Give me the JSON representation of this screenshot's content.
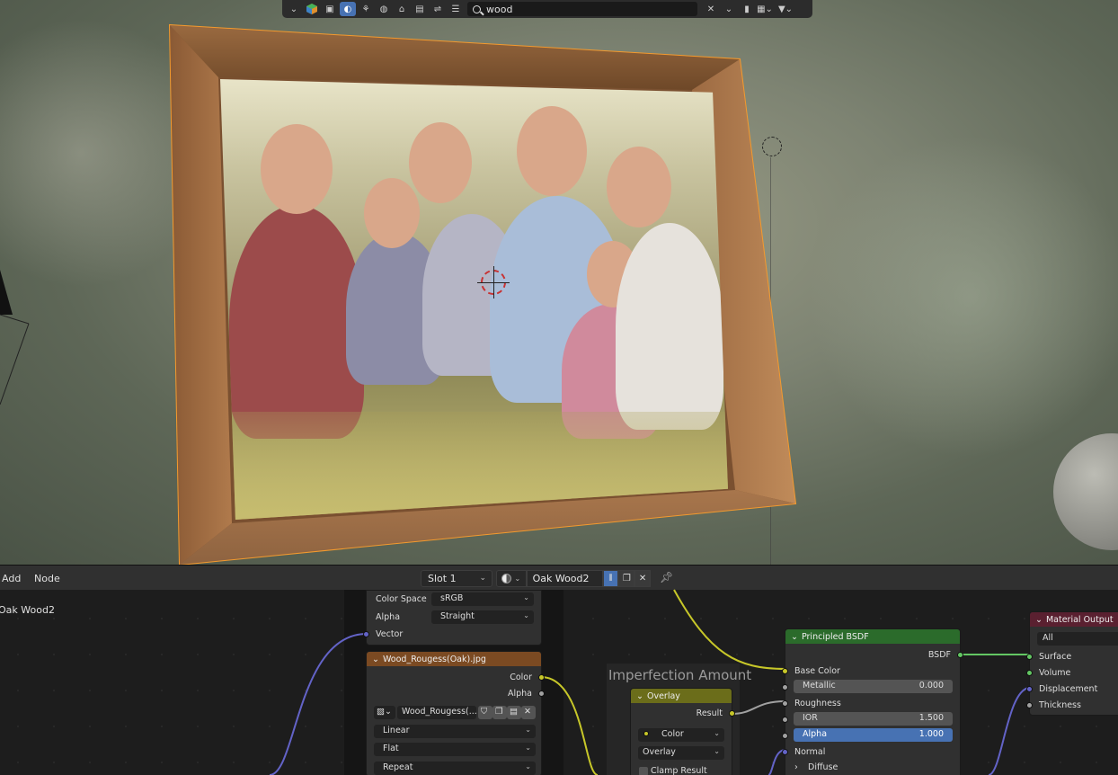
{
  "viewport_header": {
    "search_value": "wood"
  },
  "node_editor": {
    "menu": {
      "add": "Add",
      "node": "Node"
    },
    "slot": "Slot 1",
    "material_name": "Oak Wood2",
    "left_label": "Oak Wood2",
    "frame_label": "Imperfection Amount",
    "image_node_top": {
      "color_space_label": "Color Space",
      "color_space_value": "sRGB",
      "alpha_label": "Alpha",
      "alpha_value": "Straight",
      "vector_label": "Vector"
    },
    "image_node": {
      "title": "Wood_Rougess(Oak).jpg",
      "out_color": "Color",
      "out_alpha": "Alpha",
      "image_name": "Wood_Rougess(...",
      "interpolation": "Linear",
      "projection": "Flat",
      "extension": "Repeat"
    },
    "overlay_node": {
      "title": "Overlay",
      "result": "Result",
      "type": "Color",
      "blend": "Overlay",
      "clamp": "Clamp Result"
    },
    "bsdf_node": {
      "title": "Principled BSDF",
      "out_bsdf": "BSDF",
      "base_color": "Base Color",
      "metallic": "Metallic",
      "metallic_value": "0.000",
      "roughness": "Roughness",
      "ior": "IOR",
      "ior_value": "1.500",
      "alpha": "Alpha",
      "alpha_value": "1.000",
      "normal": "Normal",
      "diffuse": "Diffuse"
    },
    "output_node": {
      "title": "Material Output",
      "target": "All",
      "surface": "Surface",
      "volume": "Volume",
      "displacement": "Displacement",
      "thickness": "Thickness"
    }
  },
  "colors": {
    "selection_outline": "#f39a2e",
    "active_blue": "#4772b3",
    "image_node_header": "#7b4a22",
    "overlay_header": "#6b6d1a",
    "bsdf_header": "#2b6b2b",
    "output_header": "#5a2030"
  }
}
